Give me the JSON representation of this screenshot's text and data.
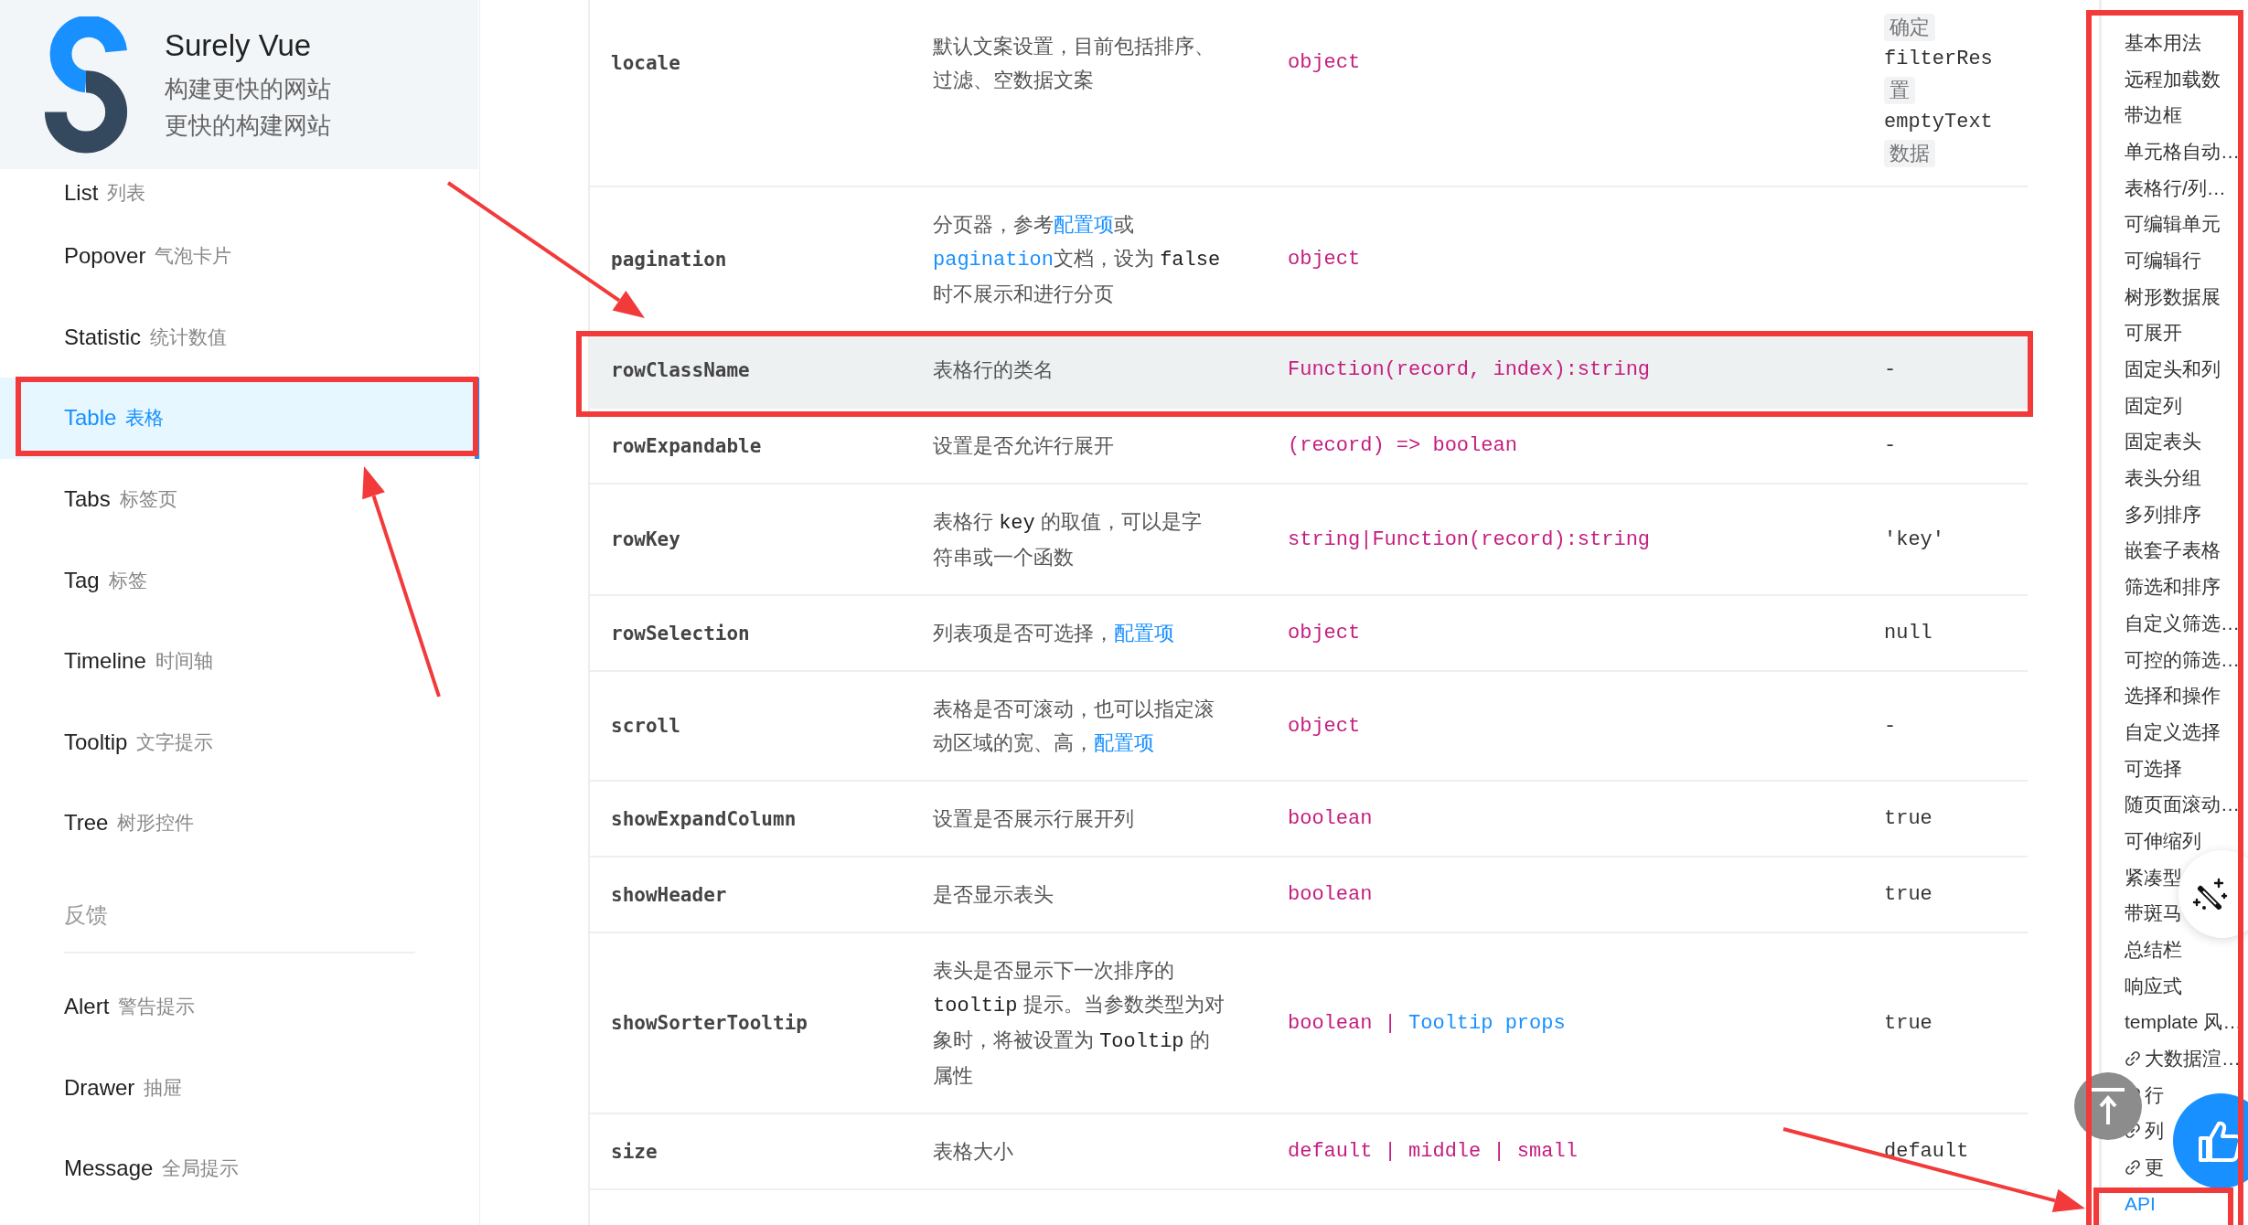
{
  "logo": {
    "title": "Surely Vue",
    "taglines": [
      "构建更快的网站",
      "更快的构建网站"
    ]
  },
  "sidebar": {
    "items": [
      {
        "kind": "item",
        "label": "List",
        "sublabel": "列表",
        "selected": false
      },
      {
        "kind": "item",
        "label": "Popover",
        "sublabel": "气泡卡片",
        "selected": false
      },
      {
        "kind": "item",
        "label": "Statistic",
        "sublabel": "统计数值",
        "selected": false
      },
      {
        "kind": "item",
        "label": "Table",
        "sublabel": "表格",
        "selected": true
      },
      {
        "kind": "item",
        "label": "Tabs",
        "sublabel": "标签页",
        "selected": false
      },
      {
        "kind": "item",
        "label": "Tag",
        "sublabel": "标签",
        "selected": false
      },
      {
        "kind": "item",
        "label": "Timeline",
        "sublabel": "时间轴",
        "selected": false
      },
      {
        "kind": "item",
        "label": "Tooltip",
        "sublabel": "文字提示",
        "selected": false
      },
      {
        "kind": "item",
        "label": "Tree",
        "sublabel": "树形控件",
        "selected": false
      },
      {
        "kind": "group",
        "label": "反馈"
      },
      {
        "kind": "item",
        "label": "Alert",
        "sublabel": "警告提示",
        "selected": false
      },
      {
        "kind": "item",
        "label": "Drawer",
        "sublabel": "抽屉",
        "selected": false
      },
      {
        "kind": "item",
        "label": "Message",
        "sublabel": "全局提示",
        "selected": false
      }
    ]
  },
  "table": {
    "rows": [
      {
        "name": "locale",
        "hovered": false,
        "description": [
          [
            {
              "kind": "text",
              "text": "默认文案设置，目前包括排序、"
            }
          ],
          [
            {
              "kind": "text",
              "text": "过滤、空数据文案"
            }
          ]
        ],
        "type": [
          {
            "kind": "type",
            "text": "object"
          }
        ],
        "default": [
          {
            "kind": "chip",
            "text": "确定"
          },
          {
            "kind": "code",
            "text": "filterRes"
          },
          {
            "kind": "chip",
            "text": "置"
          },
          {
            "kind": "code",
            "text": "emptyText"
          },
          {
            "kind": "chip",
            "text": "数据"
          }
        ]
      },
      {
        "name": "pagination",
        "hovered": false,
        "description": [
          [
            {
              "kind": "text",
              "text": "分页器，参考"
            },
            {
              "kind": "link",
              "text": "配置项"
            },
            {
              "kind": "text",
              "text": "或"
            }
          ],
          [
            {
              "kind": "code_link",
              "text": "pagination"
            },
            {
              "kind": "text",
              "text": "文档，设为 "
            },
            {
              "kind": "code",
              "text": "false"
            }
          ],
          [
            {
              "kind": "text",
              "text": "时不展示和进行分页"
            }
          ]
        ],
        "type": [
          {
            "kind": "type",
            "text": "object"
          }
        ],
        "default": []
      },
      {
        "name": "rowClassName",
        "hovered": true,
        "description": [
          [
            {
              "kind": "text",
              "text": "表格行的类名"
            }
          ]
        ],
        "type": [
          {
            "kind": "type",
            "text": "Function(record, index):string"
          }
        ],
        "default": [
          {
            "kind": "code",
            "text": "-"
          }
        ]
      },
      {
        "name": "rowExpandable",
        "hovered": false,
        "description": [
          [
            {
              "kind": "text",
              "text": "设置是否允许行展开"
            }
          ]
        ],
        "type": [
          {
            "kind": "type",
            "text": "(record) => boolean"
          }
        ],
        "default": [
          {
            "kind": "code",
            "text": "-"
          }
        ]
      },
      {
        "name": "rowKey",
        "hovered": false,
        "description": [
          [
            {
              "kind": "text",
              "text": "表格行 "
            },
            {
              "kind": "code",
              "text": "key"
            },
            {
              "kind": "text",
              "text": " 的取值，可以是字"
            }
          ],
          [
            {
              "kind": "text",
              "text": "符串或一个函数"
            }
          ]
        ],
        "type": [
          {
            "kind": "type",
            "text": "string|Function(record):string"
          }
        ],
        "default": [
          {
            "kind": "code",
            "text": "'key'"
          }
        ]
      },
      {
        "name": "rowSelection",
        "hovered": false,
        "description": [
          [
            {
              "kind": "text",
              "text": "列表项是否可选择，"
            },
            {
              "kind": "link",
              "text": "配置项"
            }
          ]
        ],
        "type": [
          {
            "kind": "type",
            "text": "object"
          }
        ],
        "default": [
          {
            "kind": "code",
            "text": "null"
          }
        ]
      },
      {
        "name": "scroll",
        "hovered": false,
        "description": [
          [
            {
              "kind": "text",
              "text": "表格是否可滚动，也可以指定滚"
            }
          ],
          [
            {
              "kind": "text",
              "text": "动区域的宽、高，"
            },
            {
              "kind": "link",
              "text": "配置项"
            }
          ]
        ],
        "type": [
          {
            "kind": "type",
            "text": "object"
          }
        ],
        "default": [
          {
            "kind": "code",
            "text": "-"
          }
        ]
      },
      {
        "name": "showExpandColumn",
        "hovered": false,
        "description": [
          [
            {
              "kind": "text",
              "text": "设置是否展示行展开列"
            }
          ]
        ],
        "type": [
          {
            "kind": "type",
            "text": "boolean"
          }
        ],
        "default": [
          {
            "kind": "code",
            "text": "true"
          }
        ]
      },
      {
        "name": "showHeader",
        "hovered": false,
        "description": [
          [
            {
              "kind": "text",
              "text": "是否显示表头"
            }
          ]
        ],
        "type": [
          {
            "kind": "type",
            "text": "boolean"
          }
        ],
        "default": [
          {
            "kind": "code",
            "text": "true"
          }
        ]
      },
      {
        "name": "showSorterTooltip",
        "hovered": false,
        "description": [
          [
            {
              "kind": "text",
              "text": "表头是否显示下一次排序的"
            }
          ],
          [
            {
              "kind": "code",
              "text": "tooltip"
            },
            {
              "kind": "text",
              "text": " 提示。当参数类型为对"
            }
          ],
          [
            {
              "kind": "text",
              "text": "象时，将被设置为 "
            },
            {
              "kind": "code",
              "text": "Tooltip"
            },
            {
              "kind": "text",
              "text": " 的"
            }
          ],
          [
            {
              "kind": "text",
              "text": "属性"
            }
          ]
        ],
        "type": [
          {
            "kind": "type",
            "text": "boolean | "
          },
          {
            "kind": "link",
            "text": "Tooltip props"
          }
        ],
        "default": [
          {
            "kind": "code",
            "text": "true"
          }
        ]
      },
      {
        "name": "size",
        "hovered": false,
        "description": [
          [
            {
              "kind": "text",
              "text": "表格大小"
            }
          ]
        ],
        "type": [
          {
            "kind": "type",
            "text": "default | middle | small"
          }
        ],
        "default": [
          {
            "kind": "code",
            "text": "default"
          }
        ]
      }
    ]
  },
  "toc": {
    "items": [
      {
        "kind": "anchor",
        "label": "基本用法",
        "selected": false
      },
      {
        "kind": "anchor",
        "label": "远程加载数",
        "selected": false
      },
      {
        "kind": "anchor",
        "label": "带边框",
        "selected": false
      },
      {
        "kind": "anchor",
        "label": "单元格自动…",
        "selected": false
      },
      {
        "kind": "anchor",
        "label": "表格行/列…",
        "selected": false
      },
      {
        "kind": "anchor",
        "label": "可编辑单元",
        "selected": false
      },
      {
        "kind": "anchor",
        "label": "可编辑行",
        "selected": false
      },
      {
        "kind": "anchor",
        "label": "树形数据展",
        "selected": false
      },
      {
        "kind": "anchor",
        "label": "可展开",
        "selected": false
      },
      {
        "kind": "anchor",
        "label": "固定头和列",
        "selected": false
      },
      {
        "kind": "anchor",
        "label": "固定列",
        "selected": false
      },
      {
        "kind": "anchor",
        "label": "固定表头",
        "selected": false
      },
      {
        "kind": "anchor",
        "label": "表头分组",
        "selected": false
      },
      {
        "kind": "anchor",
        "label": "多列排序",
        "selected": false
      },
      {
        "kind": "anchor",
        "label": "嵌套子表格",
        "selected": false
      },
      {
        "kind": "anchor",
        "label": "筛选和排序",
        "selected": false
      },
      {
        "kind": "anchor",
        "label": "自定义筛选…",
        "selected": false
      },
      {
        "kind": "anchor",
        "label": "可控的筛选…",
        "selected": false
      },
      {
        "kind": "anchor",
        "label": "选择和操作",
        "selected": false
      },
      {
        "kind": "anchor",
        "label": "自定义选择",
        "selected": false
      },
      {
        "kind": "anchor",
        "label": "可选择",
        "selected": false
      },
      {
        "kind": "anchor",
        "label": "随页面滚动…",
        "selected": false
      },
      {
        "kind": "anchor",
        "label": "可伸缩列",
        "selected": false
      },
      {
        "kind": "anchor",
        "label": "紧凑型",
        "selected": false
      },
      {
        "kind": "anchor",
        "label": "带斑马",
        "selected": false
      },
      {
        "kind": "anchor",
        "label": "总结栏",
        "selected": false
      },
      {
        "kind": "anchor",
        "label": "响应式",
        "selected": false
      },
      {
        "kind": "anchor",
        "label": "template 风…",
        "selected": false
      },
      {
        "kind": "link",
        "label": "大数据渲…",
        "selected": false
      },
      {
        "kind": "link",
        "label": "行",
        "selected": false
      },
      {
        "kind": "link",
        "label": "列",
        "selected": false
      },
      {
        "kind": "link",
        "label": "更",
        "selected": false
      },
      {
        "kind": "anchor",
        "label": "API",
        "selected": true
      }
    ]
  },
  "floating_buttons": [
    {
      "kind": "magic"
    },
    {
      "kind": "back_to_top"
    },
    {
      "kind": "like"
    }
  ],
  "annotations": [
    {
      "kind": "frame"
    },
    {
      "kind": "frame"
    },
    {
      "kind": "frame"
    },
    {
      "kind": "frame"
    },
    {
      "kind": "arrow"
    },
    {
      "kind": "arrow"
    },
    {
      "kind": "arrow"
    }
  ]
}
